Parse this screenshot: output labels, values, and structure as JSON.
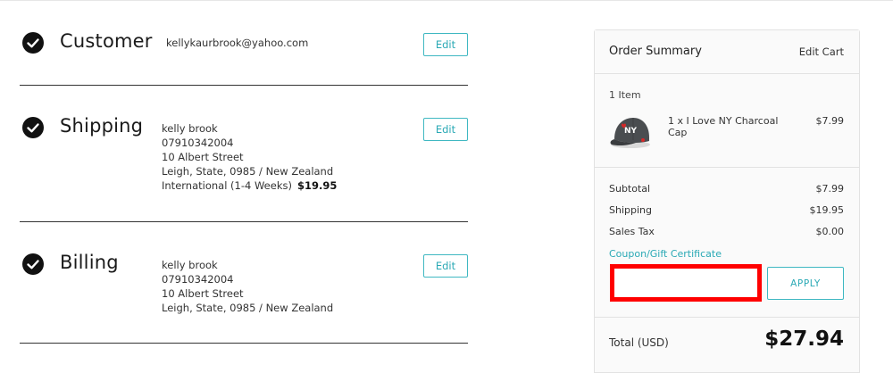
{
  "steps": {
    "customer": {
      "title": "Customer",
      "email": "kellykaurbrook@yahoo.com",
      "edit_label": "Edit"
    },
    "shipping": {
      "title": "Shipping",
      "name": "kelly brook",
      "phone": "07910342004",
      "street": "10 Albert Street",
      "city_line": "Leigh, State, 0985 / New Zealand",
      "method": "International (1-4 Weeks)",
      "method_price": "$19.95",
      "edit_label": "Edit"
    },
    "billing": {
      "title": "Billing",
      "name": "kelly brook",
      "phone": "07910342004",
      "street": "10 Albert Street",
      "city_line": "Leigh, State, 0985 / New Zealand",
      "edit_label": "Edit"
    }
  },
  "summary": {
    "title": "Order Summary",
    "edit_cart": "Edit Cart",
    "item_count": "1 Item",
    "item": {
      "name": "1 x I Love NY Charcoal Cap",
      "price": "$7.99",
      "thumbnail_icon": "cap-product-image"
    },
    "subtotal_label": "Subtotal",
    "subtotal_value": "$7.99",
    "shipping_label": "Shipping",
    "shipping_value": "$19.95",
    "tax_label": "Sales Tax",
    "tax_value": "$0.00",
    "coupon_link": "Coupon/Gift Certificate",
    "coupon_value": "",
    "apply_label": "APPLY",
    "total_label": "Total (USD)",
    "total_value": "$27.94"
  },
  "colors": {
    "accent": "#2aa9b5",
    "highlight_border": "#ff0000",
    "check_bg": "#111111"
  }
}
